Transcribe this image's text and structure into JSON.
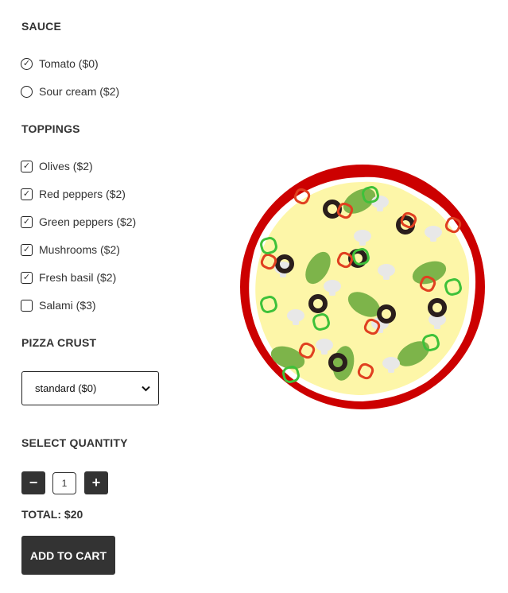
{
  "sauce": {
    "heading": "SAUCE",
    "options": [
      {
        "label": "Tomato ($0)",
        "selected": true
      },
      {
        "label": "Sour cream ($2)",
        "selected": false
      }
    ]
  },
  "toppings": {
    "heading": "TOPPINGS",
    "options": [
      {
        "label": "Olives ($2)",
        "checked": true
      },
      {
        "label": "Red peppers ($2)",
        "checked": true
      },
      {
        "label": "Green peppers ($2)",
        "checked": true
      },
      {
        "label": "Mushrooms ($2)",
        "checked": true
      },
      {
        "label": "Fresh basil ($2)",
        "checked": true
      },
      {
        "label": "Salami ($3)",
        "checked": false
      }
    ]
  },
  "crust": {
    "heading": "PIZZA CRUST",
    "selected": "standard ($0)"
  },
  "quantity": {
    "heading": "SELECT QUANTITY",
    "minus": "−",
    "plus": "+",
    "value": "1"
  },
  "total": "TOTAL: $20",
  "cart_button": "ADD TO CART",
  "colors": {
    "dark": "#333333",
    "crust": "#cc0000",
    "cheese": "#fdf6a8",
    "basil": "#7db44a",
    "green_pepper": "#3ec13a",
    "red_pepper": "#e04020",
    "olive": "#2a1e1c",
    "mushroom": "#e8e8e8"
  }
}
